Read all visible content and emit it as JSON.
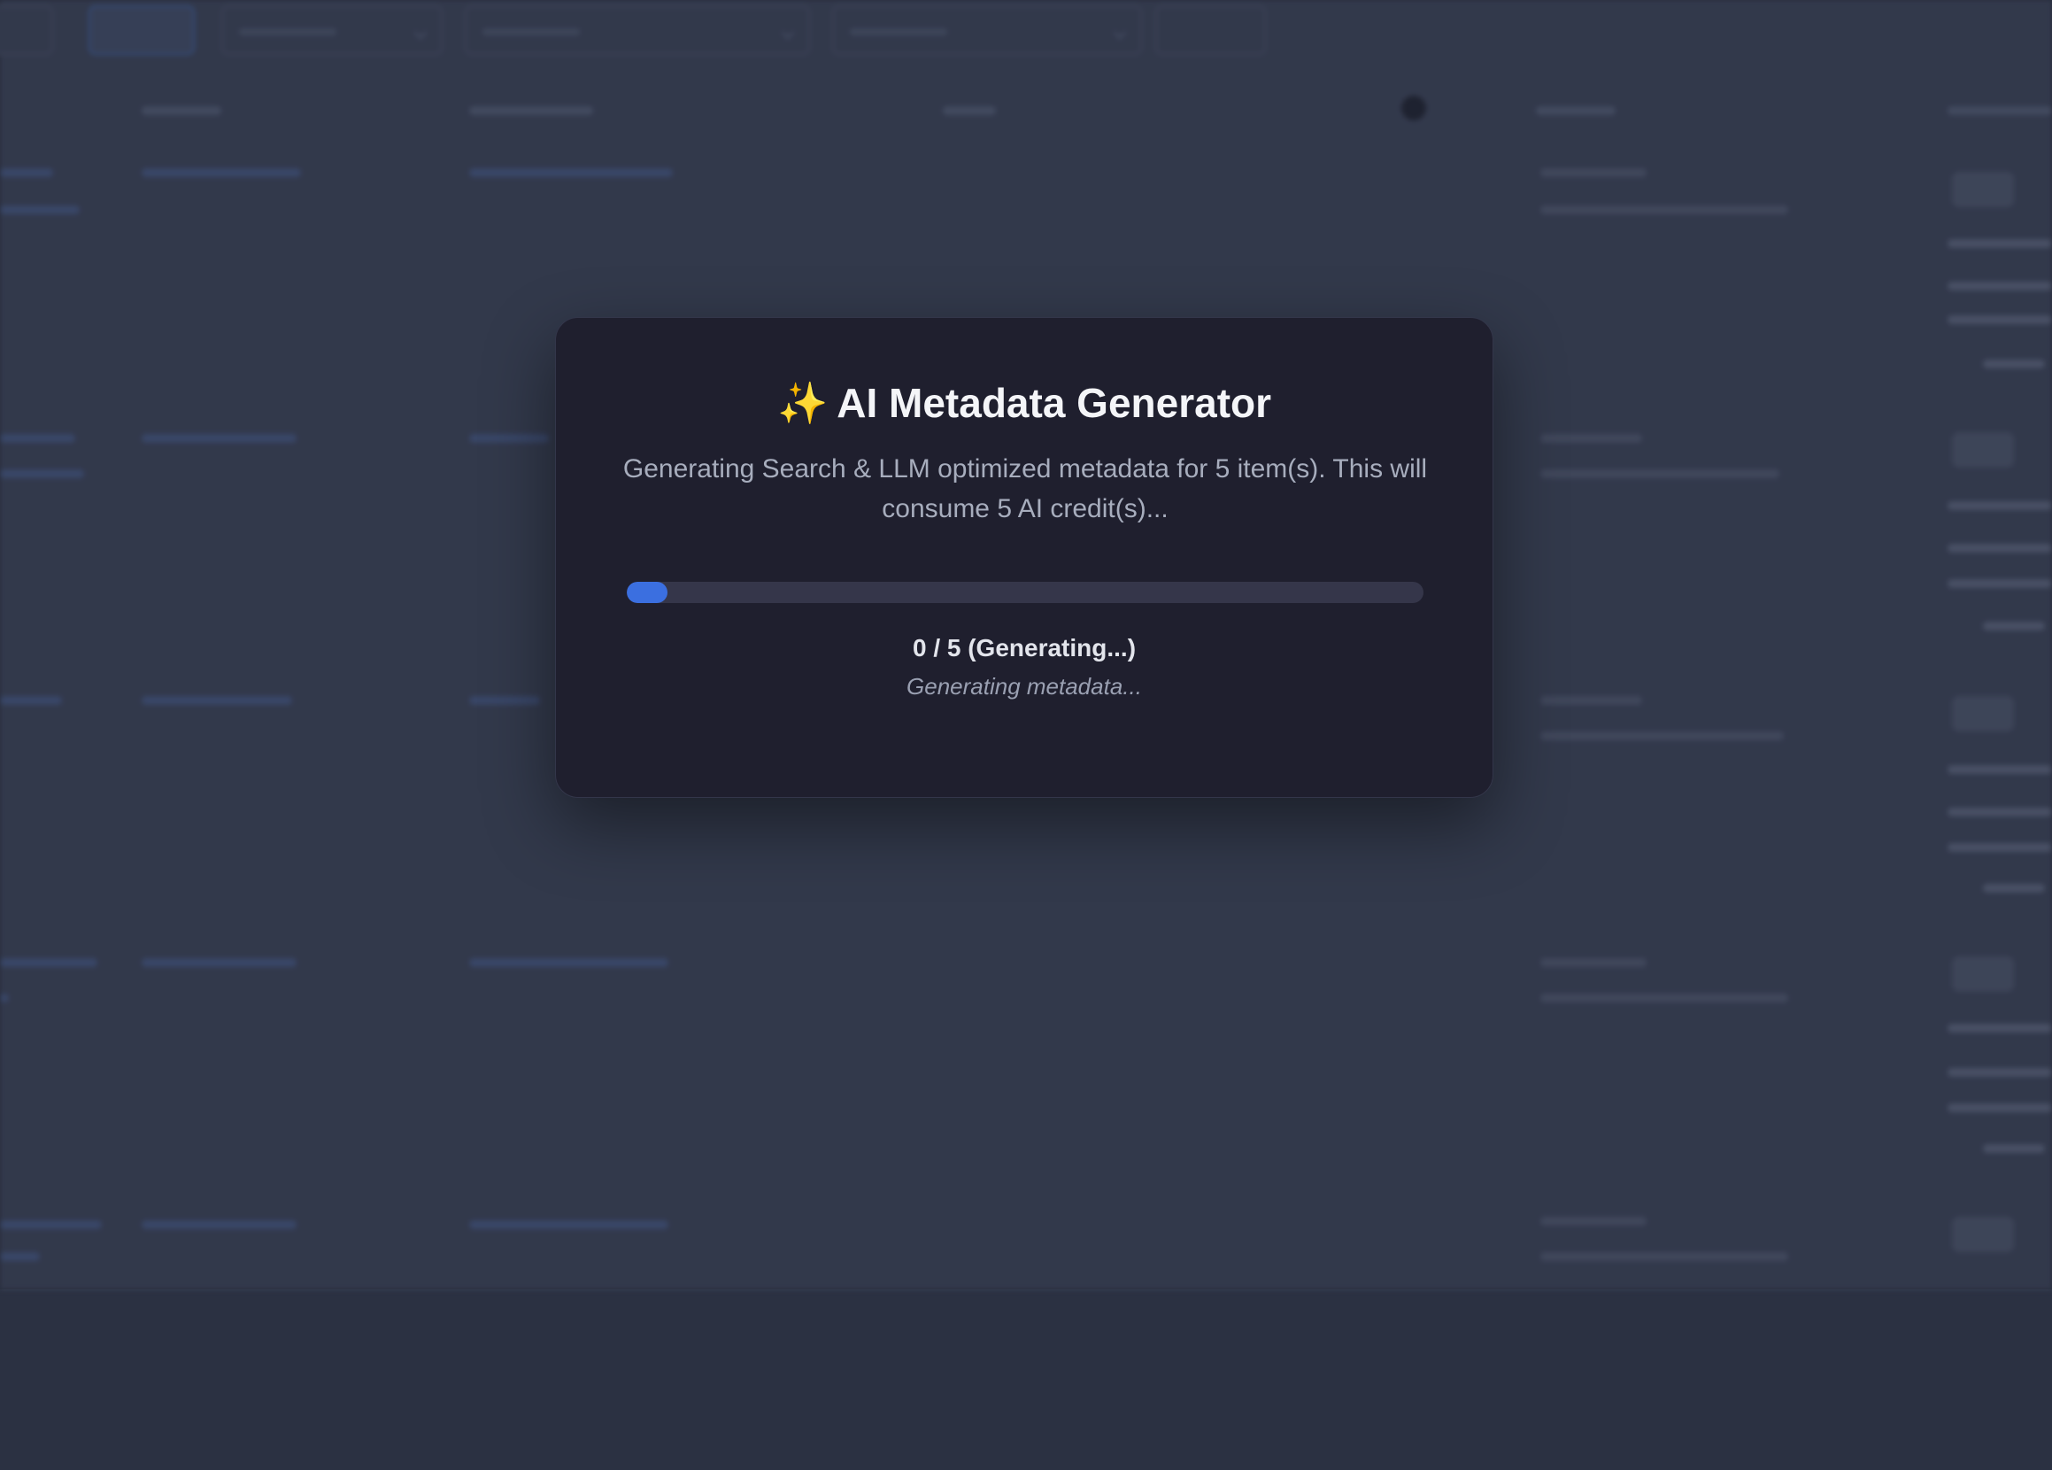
{
  "modal": {
    "sparkle_icon": "✨",
    "title": "AI Metadata Generator",
    "description": "Generating Search & LLM optimized metadata for 5 item(s). This will consume 5 AI credit(s)...",
    "progress": {
      "completed": 0,
      "total": 5,
      "count_label": "0 / 5 (Generating...)",
      "status_text": "Generating metadata...",
      "accent_color": "#3b6fe0"
    }
  },
  "background": {
    "row_count": 5
  }
}
